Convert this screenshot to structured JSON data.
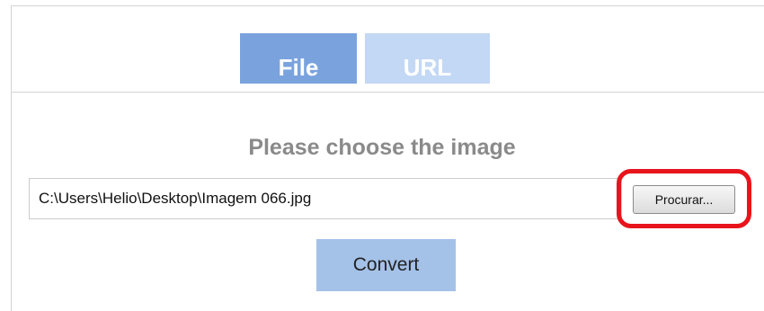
{
  "tabs": [
    {
      "label": "File",
      "active": true
    },
    {
      "label": "URL",
      "active": false
    }
  ],
  "main": {
    "heading": "Please choose the image",
    "file_path": "C:\\Users\\Helio\\Desktop\\Imagem 066.jpg",
    "browse_label": "Procurar...",
    "convert_label": "Convert"
  },
  "colors": {
    "active_tab": "#7aa3de",
    "inactive_tab": "#c3d8f4",
    "convert_button": "#a4c1e8",
    "highlight": "#e8141c",
    "heading_text": "#8a8a8a"
  }
}
